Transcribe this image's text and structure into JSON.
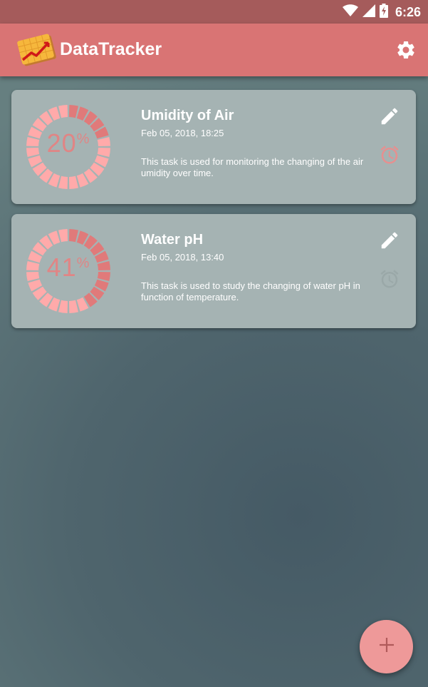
{
  "status_bar": {
    "time": "6:26",
    "icons": [
      "wifi-icon",
      "signal-icon",
      "battery-charging-icon"
    ]
  },
  "app_bar": {
    "title": "DataTracker",
    "logo_icon": "chart-logo-icon",
    "settings_icon": "gear-icon"
  },
  "colors": {
    "status_bar": "#a55b5b",
    "app_bar": "#d97474",
    "card": "#a5b3b3",
    "gauge_filled": "#e07a7a",
    "gauge_empty": "#ffaaaa",
    "alarm_active": "#e69090",
    "alarm_inactive": "#9aa8a8",
    "fab": "#ee9999"
  },
  "tasks": [
    {
      "title": "Umidity of Air",
      "date": "Feb 05, 2018, 18:25",
      "description": "This task is used for monitoring the changing of the air umidity over time.",
      "progress_value": "20",
      "progress_fraction": 0.2,
      "progress_unit": "%",
      "alarm_active": true
    },
    {
      "title": "Water pH",
      "date": "Feb 05, 2018, 13:40",
      "description": "This task is used to study the changing of water pH in function of temperature.",
      "progress_value": "41",
      "progress_fraction": 0.41,
      "progress_unit": "%",
      "alarm_active": false
    }
  ],
  "fab": {
    "icon": "plus-icon"
  }
}
